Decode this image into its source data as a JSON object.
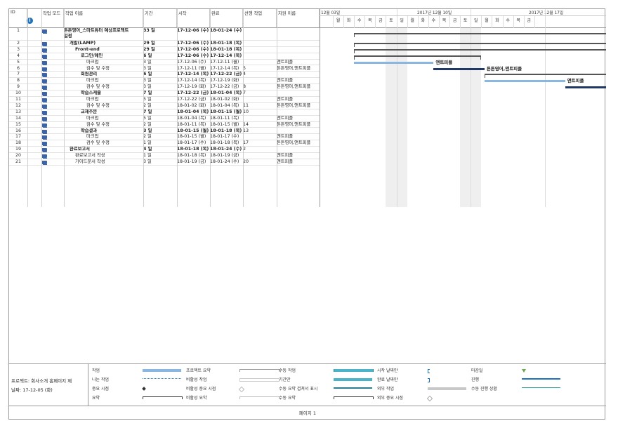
{
  "headers": {
    "id": "ID",
    "mode": "작업 모드",
    "name": "작업 이름",
    "duration": "기간",
    "start": "시작",
    "finish": "완료",
    "pred": "선행 작업",
    "res": "자원 이름"
  },
  "timescale": {
    "weeks": [
      "12월 03일",
      "2017년 12월 10일",
      "2017년 12월 17일"
    ],
    "days": [
      "월",
      "화",
      "수",
      "목",
      "금",
      "토",
      "일",
      "월",
      "화",
      "수",
      "목",
      "금",
      "토",
      "일",
      "월",
      "화",
      "수",
      "목",
      "금"
    ]
  },
  "tasks": [
    {
      "id": "1",
      "name": "튼튼영어_스마트튜터 예상프로젝트 일정",
      "duration": "33 일",
      "start": "17-12-06 (수)",
      "finish": "18-01-24 (수)",
      "pred": "",
      "res": "",
      "bold": true,
      "indent": 0
    },
    {
      "id": "2",
      "name": "개발(LAMP)",
      "duration": "29 일",
      "start": "17-12-06 (수)",
      "finish": "18-01-18 (목)",
      "pred": "",
      "res": "",
      "bold": true,
      "indent": 1
    },
    {
      "id": "3",
      "name": "Front-end",
      "duration": "29 일",
      "start": "17-12-06 (수)",
      "finish": "18-01-18 (목)",
      "pred": "",
      "res": "",
      "bold": true,
      "indent": 2
    },
    {
      "id": "4",
      "name": "로그인/메인",
      "duration": "6 일",
      "start": "17-12-06 (수)",
      "finish": "17-12-14 (목)",
      "pred": "",
      "res": "",
      "bold": true,
      "indent": 3
    },
    {
      "id": "5",
      "name": "마크업",
      "duration": "3 일",
      "start": "17-12-06 (수)",
      "finish": "17-12-11 (월)",
      "pred": "",
      "res": "앤트피플",
      "bold": false,
      "indent": 4
    },
    {
      "id": "6",
      "name": "검수 및 수정",
      "duration": "3 일",
      "start": "17-12-11 (월)",
      "finish": "17-12-14 (목)",
      "pred": "5",
      "res": "튼튼영어,앤트피플",
      "bold": false,
      "indent": 4
    },
    {
      "id": "7",
      "name": "회원관리",
      "duration": "6 일",
      "start": "17-12-14 (목)",
      "finish": "17-12-22 (금)",
      "pred": "4",
      "res": "",
      "bold": true,
      "indent": 3
    },
    {
      "id": "8",
      "name": "마크업",
      "duration": "3 일",
      "start": "17-12-14 (목)",
      "finish": "17-12-19 (화)",
      "pred": "",
      "res": "앤트피플",
      "bold": false,
      "indent": 4
    },
    {
      "id": "9",
      "name": "검수 및 수정",
      "duration": "3 일",
      "start": "17-12-19 (화)",
      "finish": "17-12-22 (금)",
      "pred": "8",
      "res": "튼튼영어,앤트피플",
      "bold": false,
      "indent": 4
    },
    {
      "id": "10",
      "name": "학습스케줄",
      "duration": "7 일",
      "start": "17-12-22 (금)",
      "finish": "18-01-04 (목)",
      "pred": "7",
      "res": "",
      "bold": true,
      "indent": 3
    },
    {
      "id": "11",
      "name": "마크업",
      "duration": "5 일",
      "start": "17-12-22 (금)",
      "finish": "18-01-02 (화)",
      "pred": "",
      "res": "앤트피플",
      "bold": false,
      "indent": 4
    },
    {
      "id": "12",
      "name": "검수 및 수정",
      "duration": "2 일",
      "start": "18-01-02 (화)",
      "finish": "18-01-04 (목)",
      "pred": "11",
      "res": "튼튼영어,앤트피플",
      "bold": false,
      "indent": 4
    },
    {
      "id": "13",
      "name": "교재주문",
      "duration": "7 일",
      "start": "18-01-04 (목)",
      "finish": "18-01-15 (월)",
      "pred": "10",
      "res": "",
      "bold": true,
      "indent": 3
    },
    {
      "id": "14",
      "name": "마크업",
      "duration": "5 일",
      "start": "18-01-04 (목)",
      "finish": "18-01-11 (목)",
      "pred": "",
      "res": "앤트피플",
      "bold": false,
      "indent": 4
    },
    {
      "id": "15",
      "name": "검수 및 수정",
      "duration": "2 일",
      "start": "18-01-11 (목)",
      "finish": "18-01-15 (월)",
      "pred": "14",
      "res": "튼튼영어,앤트피플",
      "bold": false,
      "indent": 4
    },
    {
      "id": "16",
      "name": "학습결과",
      "duration": "3 일",
      "start": "18-01-15 (월)",
      "finish": "18-01-18 (목)",
      "pred": "13",
      "res": "",
      "bold": true,
      "indent": 3
    },
    {
      "id": "17",
      "name": "마크업",
      "duration": "2 일",
      "start": "18-01-15 (월)",
      "finish": "18-01-17 (수)",
      "pred": "",
      "res": "앤트피플",
      "bold": false,
      "indent": 4
    },
    {
      "id": "18",
      "name": "검수 및 수정",
      "duration": "1 일",
      "start": "18-01-17 (수)",
      "finish": "18-01-18 (목)",
      "pred": "17",
      "res": "튼튼영어,앤트피플",
      "bold": false,
      "indent": 4
    },
    {
      "id": "19",
      "name": "완료보고서",
      "duration": "4 일",
      "start": "18-01-18 (목)",
      "finish": "18-01-24 (수)",
      "pred": "2",
      "res": "",
      "bold": true,
      "indent": 1
    },
    {
      "id": "20",
      "name": "완료보고서 작성",
      "duration": "1 일",
      "start": "18-01-18 (목)",
      "finish": "18-01-19 (금)",
      "pred": "",
      "res": "앤트피플",
      "bold": false,
      "indent": 2
    },
    {
      "id": "21",
      "name": "가이드문서 작성",
      "duration": "3 일",
      "start": "18-01-19 (금)",
      "finish": "18-01-24 (수)",
      "pred": "20",
      "res": "앤트피플",
      "bold": false,
      "indent": 2
    }
  ],
  "bar_labels": {
    "b5": "앤트피플",
    "b6": "튼튼영어,앤트피플",
    "b8": "앤트피플"
  },
  "legend": {
    "project": "프로젝트: 회사소개 홈페이지 제",
    "date": "날짜: 17-12-05 (화)",
    "items": [
      "작업",
      "나눈 작업",
      "중요 시점",
      "요약",
      "프로젝트 요약",
      "비활성 작업",
      "비활성 중요 시점",
      "비활성 요약",
      "수동 작업",
      "기간만",
      "수동 요약 겹쳐서 표시",
      "수동 요약",
      "시작 날짜만",
      "완료 날짜만",
      "외부 작업",
      "외부 중요 시점",
      "마감일",
      "진행",
      "수동 진행 상황"
    ]
  },
  "footer": "페이지 1",
  "colors": {
    "task": "#8ab7e2",
    "critical": "#1f3864",
    "summary": "#555555",
    "progress": "#1e73be",
    "manual": "#4ab4c8",
    "deadline": "#6aa84f"
  }
}
